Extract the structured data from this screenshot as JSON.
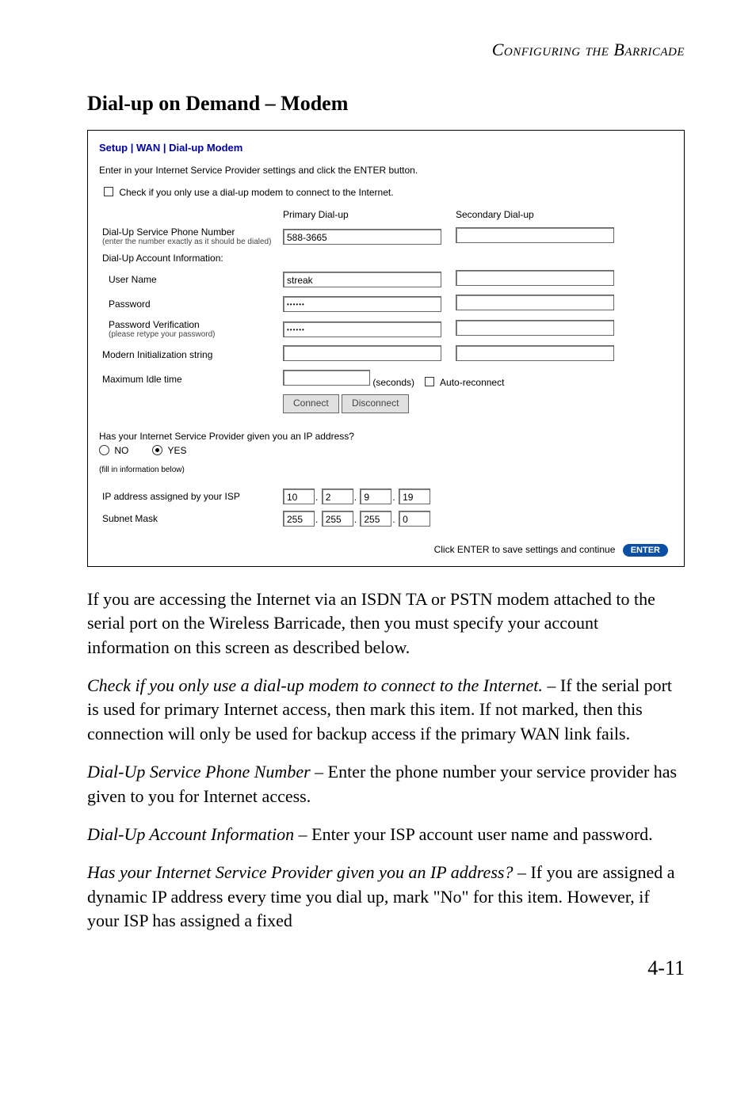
{
  "runningHead": "Configuring the Barricade",
  "sectionHeading": "Dial-up on Demand – Modem",
  "shot": {
    "title": "Setup | WAN | Dial-up Modem",
    "intro": "Enter in your Internet Service Provider settings and click the ENTER button.",
    "checkLabel": "Check if you only use a dial-up modem to connect to the Internet.",
    "colPrimary": "Primary Dial-up",
    "colSecondary": "Secondary Dial-up",
    "phoneLabel": "Dial-Up Service Phone Number",
    "phoneSub": "(enter the number exactly as it should be dialed)",
    "phoneValue": "588-3665",
    "acctInfoLabel": "Dial-Up Account Information:",
    "userLabel": "User Name",
    "userValue": "streak",
    "pwdLabel": "Password",
    "pwdValue": "••••••",
    "pwdVerLabel": "Password Verification",
    "pwdVerSub": "(please retype your password)",
    "pwdVerValue": "••••••",
    "modemInitLabel": "Modern Initialization string",
    "maxIdleLabel": "Maximum Idle time",
    "secondsLabel": "(seconds)",
    "autoReconnect": "Auto-reconnect",
    "connect": "Connect",
    "disconnect": "Disconnect",
    "ipQuestion": "Has your Internet Service Provider given you an IP address?",
    "no": "NO",
    "yes": "YES",
    "fillBelow": "(fill in information below)",
    "ipAssignedLabel": "IP address assigned by your ISP",
    "subnetLabel": "Subnet Mask",
    "ip": [
      "10",
      "2",
      "9",
      "19"
    ],
    "mask": [
      "255",
      "255",
      "255",
      "0"
    ],
    "enterHint": "Click ENTER to save settings and continue",
    "enterBtn": "ENTER"
  },
  "body": {
    "p1": "If you are accessing the Internet via an ISDN TA or PSTN modem attached to the serial port on the Wireless Barricade, then you must specify your account information on this screen as described below.",
    "p2_em": "Check if you only use a dial-up modem to connect to the Internet.",
    "p2_rest": " – If the serial port is used for primary Internet access, then mark this item. If not marked, then this connection will only be used for backup access if the primary WAN link fails.",
    "p3_em": "Dial-Up Service Phone Number",
    "p3_rest": " – Enter the phone number your service provider has given to you for Internet access.",
    "p4_em": "Dial-Up Account Information",
    "p4_rest": " – Enter your ISP account user name and password.",
    "p5_em": "Has your Internet Service Provider given you an IP address?",
    "p5_rest": " – If you are assigned a dynamic IP address every time you dial up, mark \"No\" for this item. However, if your ISP has assigned a fixed"
  },
  "pageNumber": "4-11"
}
